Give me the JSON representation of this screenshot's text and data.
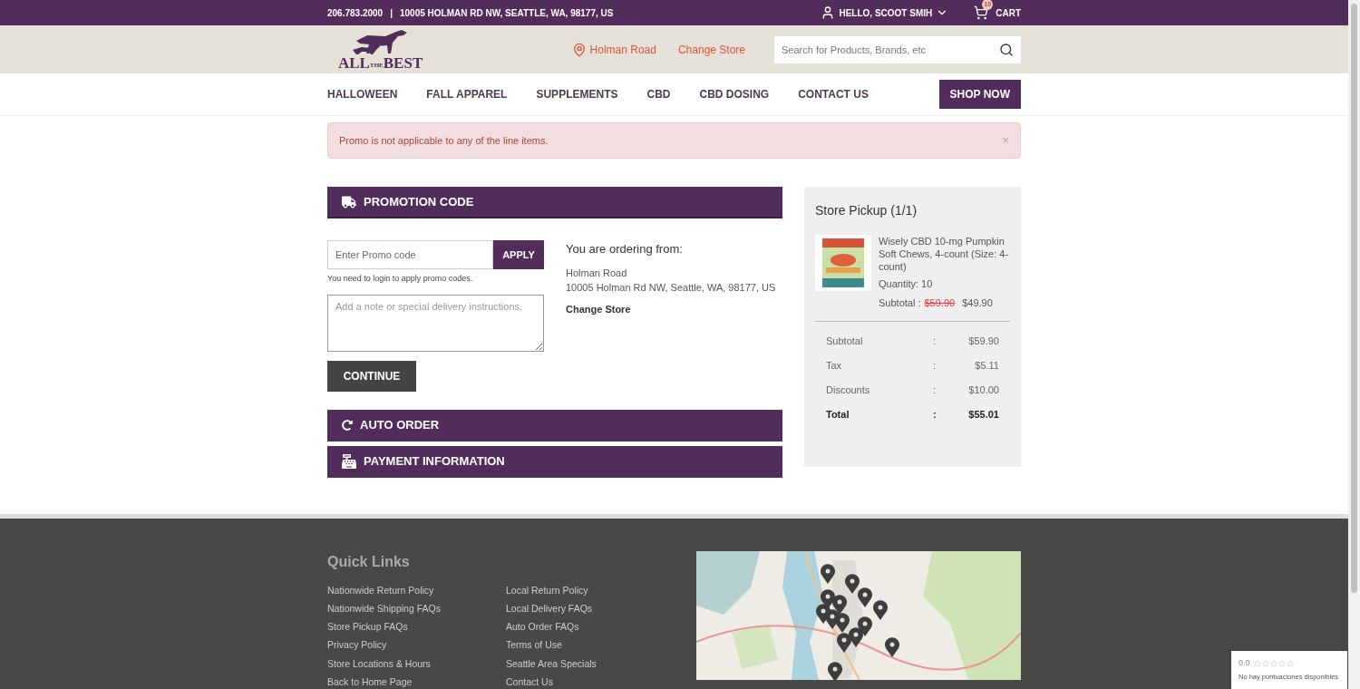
{
  "top_bar": {
    "phone": "206.783.2000",
    "separator": "|",
    "address": "10005 HOLMAN RD NW, SEATTLE, WA, 98177, US",
    "user": "HELLO, SCOOT SMIH",
    "cart_label": "CART",
    "cart_count": "10"
  },
  "header": {
    "logo": {
      "first": "ALL",
      "middle": "THE",
      "last": "BEST"
    },
    "store": "Holman Road",
    "change_store": "Change Store",
    "search": {
      "placeholder": "Search for Products, Brands, etc"
    }
  },
  "nav": {
    "items": [
      "HALLOWEEN",
      "FALL APPAREL",
      "SUPPLEMENTS",
      "CBD",
      "CBD DOSING",
      "CONTACT US"
    ],
    "cta": "SHOP NOW"
  },
  "alert": {
    "message": "Promo is not applicable to any of the line items.",
    "close": "×"
  },
  "sections": [
    {
      "kind": "promotion",
      "title": "PROMOTION CODE",
      "expanded": true
    },
    {
      "kind": "auto_order",
      "title": "AUTO ORDER",
      "expanded": false
    },
    {
      "kind": "payment",
      "title": "PAYMENT INFORMATION",
      "expanded": false
    }
  ],
  "promo": {
    "placeholder": "Enter Promo code",
    "apply": "APPLY",
    "hint": "You need to login to apply promo codes.",
    "note_placeholder": "Add a note or special delivery instructions.",
    "continue": "CONTINUE"
  },
  "ordering_from": {
    "heading": "You are ordering from:",
    "store": "Holman Road",
    "address": "10005 Holman Rd NW, Seattle, WA, 98177, US",
    "change": "Change Store"
  },
  "summary": {
    "title": "Store Pickup (1/1)",
    "item": {
      "name": "Wisely CBD 10-mg Pumpkin Soft Chews, 4-count (Size: 4-count)",
      "quantity": "Quantity: 10",
      "subtotal_label": "Subtotal :",
      "old_price": "$59.90",
      "price": "$49.90"
    },
    "rows": [
      {
        "kind": "line",
        "label": "Subtotal",
        "sep": ":",
        "value": "$59.90"
      },
      {
        "kind": "line",
        "label": "Tax",
        "sep": ":",
        "value": "$5.11"
      },
      {
        "kind": "line",
        "label": "Discounts",
        "sep": ":",
        "value": "$10.00"
      },
      {
        "kind": "total",
        "label": "Total",
        "sep": ":",
        "value": "$55.01"
      }
    ]
  },
  "footer": {
    "title": "Quick Links",
    "columns": [
      [
        "Nationwide Return Policy",
        "Nationwide Shipping FAQs",
        "Store Pickup FAQs",
        "Privacy Policy",
        "Store Locations & Hours",
        "Back to Home Page"
      ],
      [
        "Local Return Policy",
        "Local Delivery FAQs",
        "Auto Order FAQs",
        "Terms of Use",
        "Seattle Area Specials",
        "Contact Us"
      ]
    ]
  },
  "rating_badge": {
    "score": "0.0",
    "stars": 0,
    "text": "No hay puntuaciones disponibles"
  }
}
